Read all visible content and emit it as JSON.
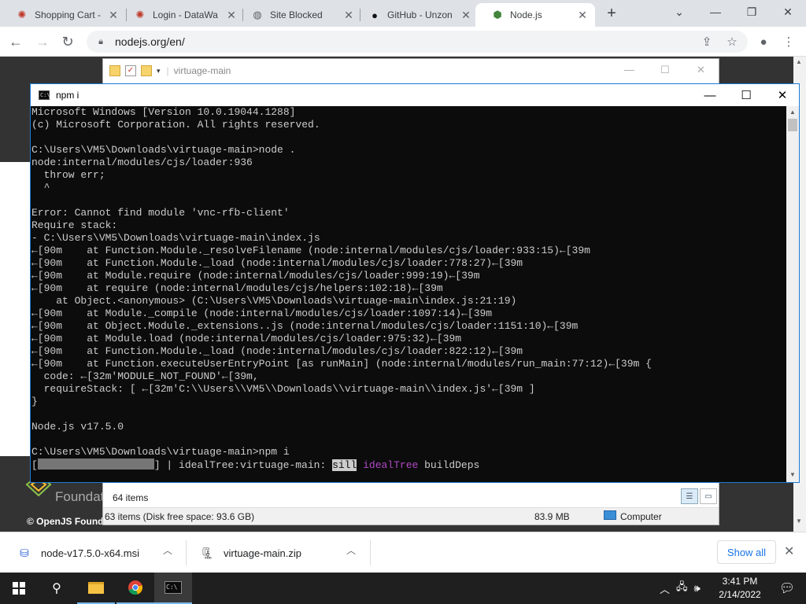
{
  "browser": {
    "tabs": [
      {
        "title": "Shopping Cart - ",
        "icon": "gear-favicon"
      },
      {
        "title": "Login - DataWa",
        "icon": "gear-favicon"
      },
      {
        "title": "Site Blocked",
        "icon": "globe-favicon"
      },
      {
        "title": "GitHub - Unzon",
        "icon": "github-favicon"
      },
      {
        "title": "Node.js",
        "icon": "nodejs-favicon",
        "active": true
      }
    ],
    "url": "nodejs.org/en/"
  },
  "page": {
    "foundation": "Foundat",
    "footer": "© OpenJS Found"
  },
  "explorer": {
    "title": "virtuage-main",
    "items": "64 items",
    "status_left": "63 items (Disk free space: 93.6 GB)",
    "size": "83.9 MB",
    "location": "Computer"
  },
  "console": {
    "title": "npm i",
    "lines": [
      "Microsoft Windows [Version 10.0.19044.1288]",
      "(c) Microsoft Corporation. All rights reserved.",
      "",
      "C:\\Users\\VM5\\Downloads\\virtuage-main>node .",
      "node:internal/modules/cjs/loader:936",
      "  throw err;",
      "  ^",
      "",
      "Error: Cannot find module 'vnc-rfb-client'",
      "Require stack:",
      "- C:\\Users\\VM5\\Downloads\\virtuage-main\\index.js",
      "←[90m    at Function.Module._resolveFilename (node:internal/modules/cjs/loader:933:15)←[39m",
      "←[90m    at Function.Module._load (node:internal/modules/cjs/loader:778:27)←[39m",
      "←[90m    at Module.require (node:internal/modules/cjs/loader:999:19)←[39m",
      "←[90m    at require (node:internal/modules/cjs/helpers:102:18)←[39m",
      "    at Object.<anonymous> (C:\\Users\\VM5\\Downloads\\virtuage-main\\index.js:21:19)",
      "←[90m    at Module._compile (node:internal/modules/cjs/loader:1097:14)←[39m",
      "←[90m    at Object.Module._extensions..js (node:internal/modules/cjs/loader:1151:10)←[39m",
      "←[90m    at Module.load (node:internal/modules/cjs/loader:975:32)←[39m",
      "←[90m    at Function.Module._load (node:internal/modules/cjs/loader:822:12)←[39m",
      "←[90m    at Function.executeUserEntryPoint [as runMain] (node:internal/modules/run_main:77:12)←[39m {",
      "  code: ←[32m'MODULE_NOT_FOUND'←[39m,",
      "  requireStack: [ ←[32m'C:\\\\Users\\\\VM5\\\\Downloads\\\\virtuage-main\\\\index.js'←[39m ]",
      "}",
      "",
      "Node.js v17.5.0",
      "",
      "C:\\Users\\VM5\\Downloads\\virtuage-main>npm i"
    ],
    "progress": {
      "open": "[",
      "close": "] | idealTree:virtuage-main: ",
      "level": "sill",
      "stage": "idealTree",
      "detail": " buildDeps"
    }
  },
  "downloads": {
    "items": [
      {
        "name": "node-v17.5.0-x64.msi",
        "icon": "msi-installer-icon"
      },
      {
        "name": "virtuage-main.zip",
        "icon": "zip-archive-icon"
      }
    ],
    "show_all": "Show all"
  },
  "taskbar": {
    "time": "3:41 PM",
    "date": "2/14/2022"
  }
}
